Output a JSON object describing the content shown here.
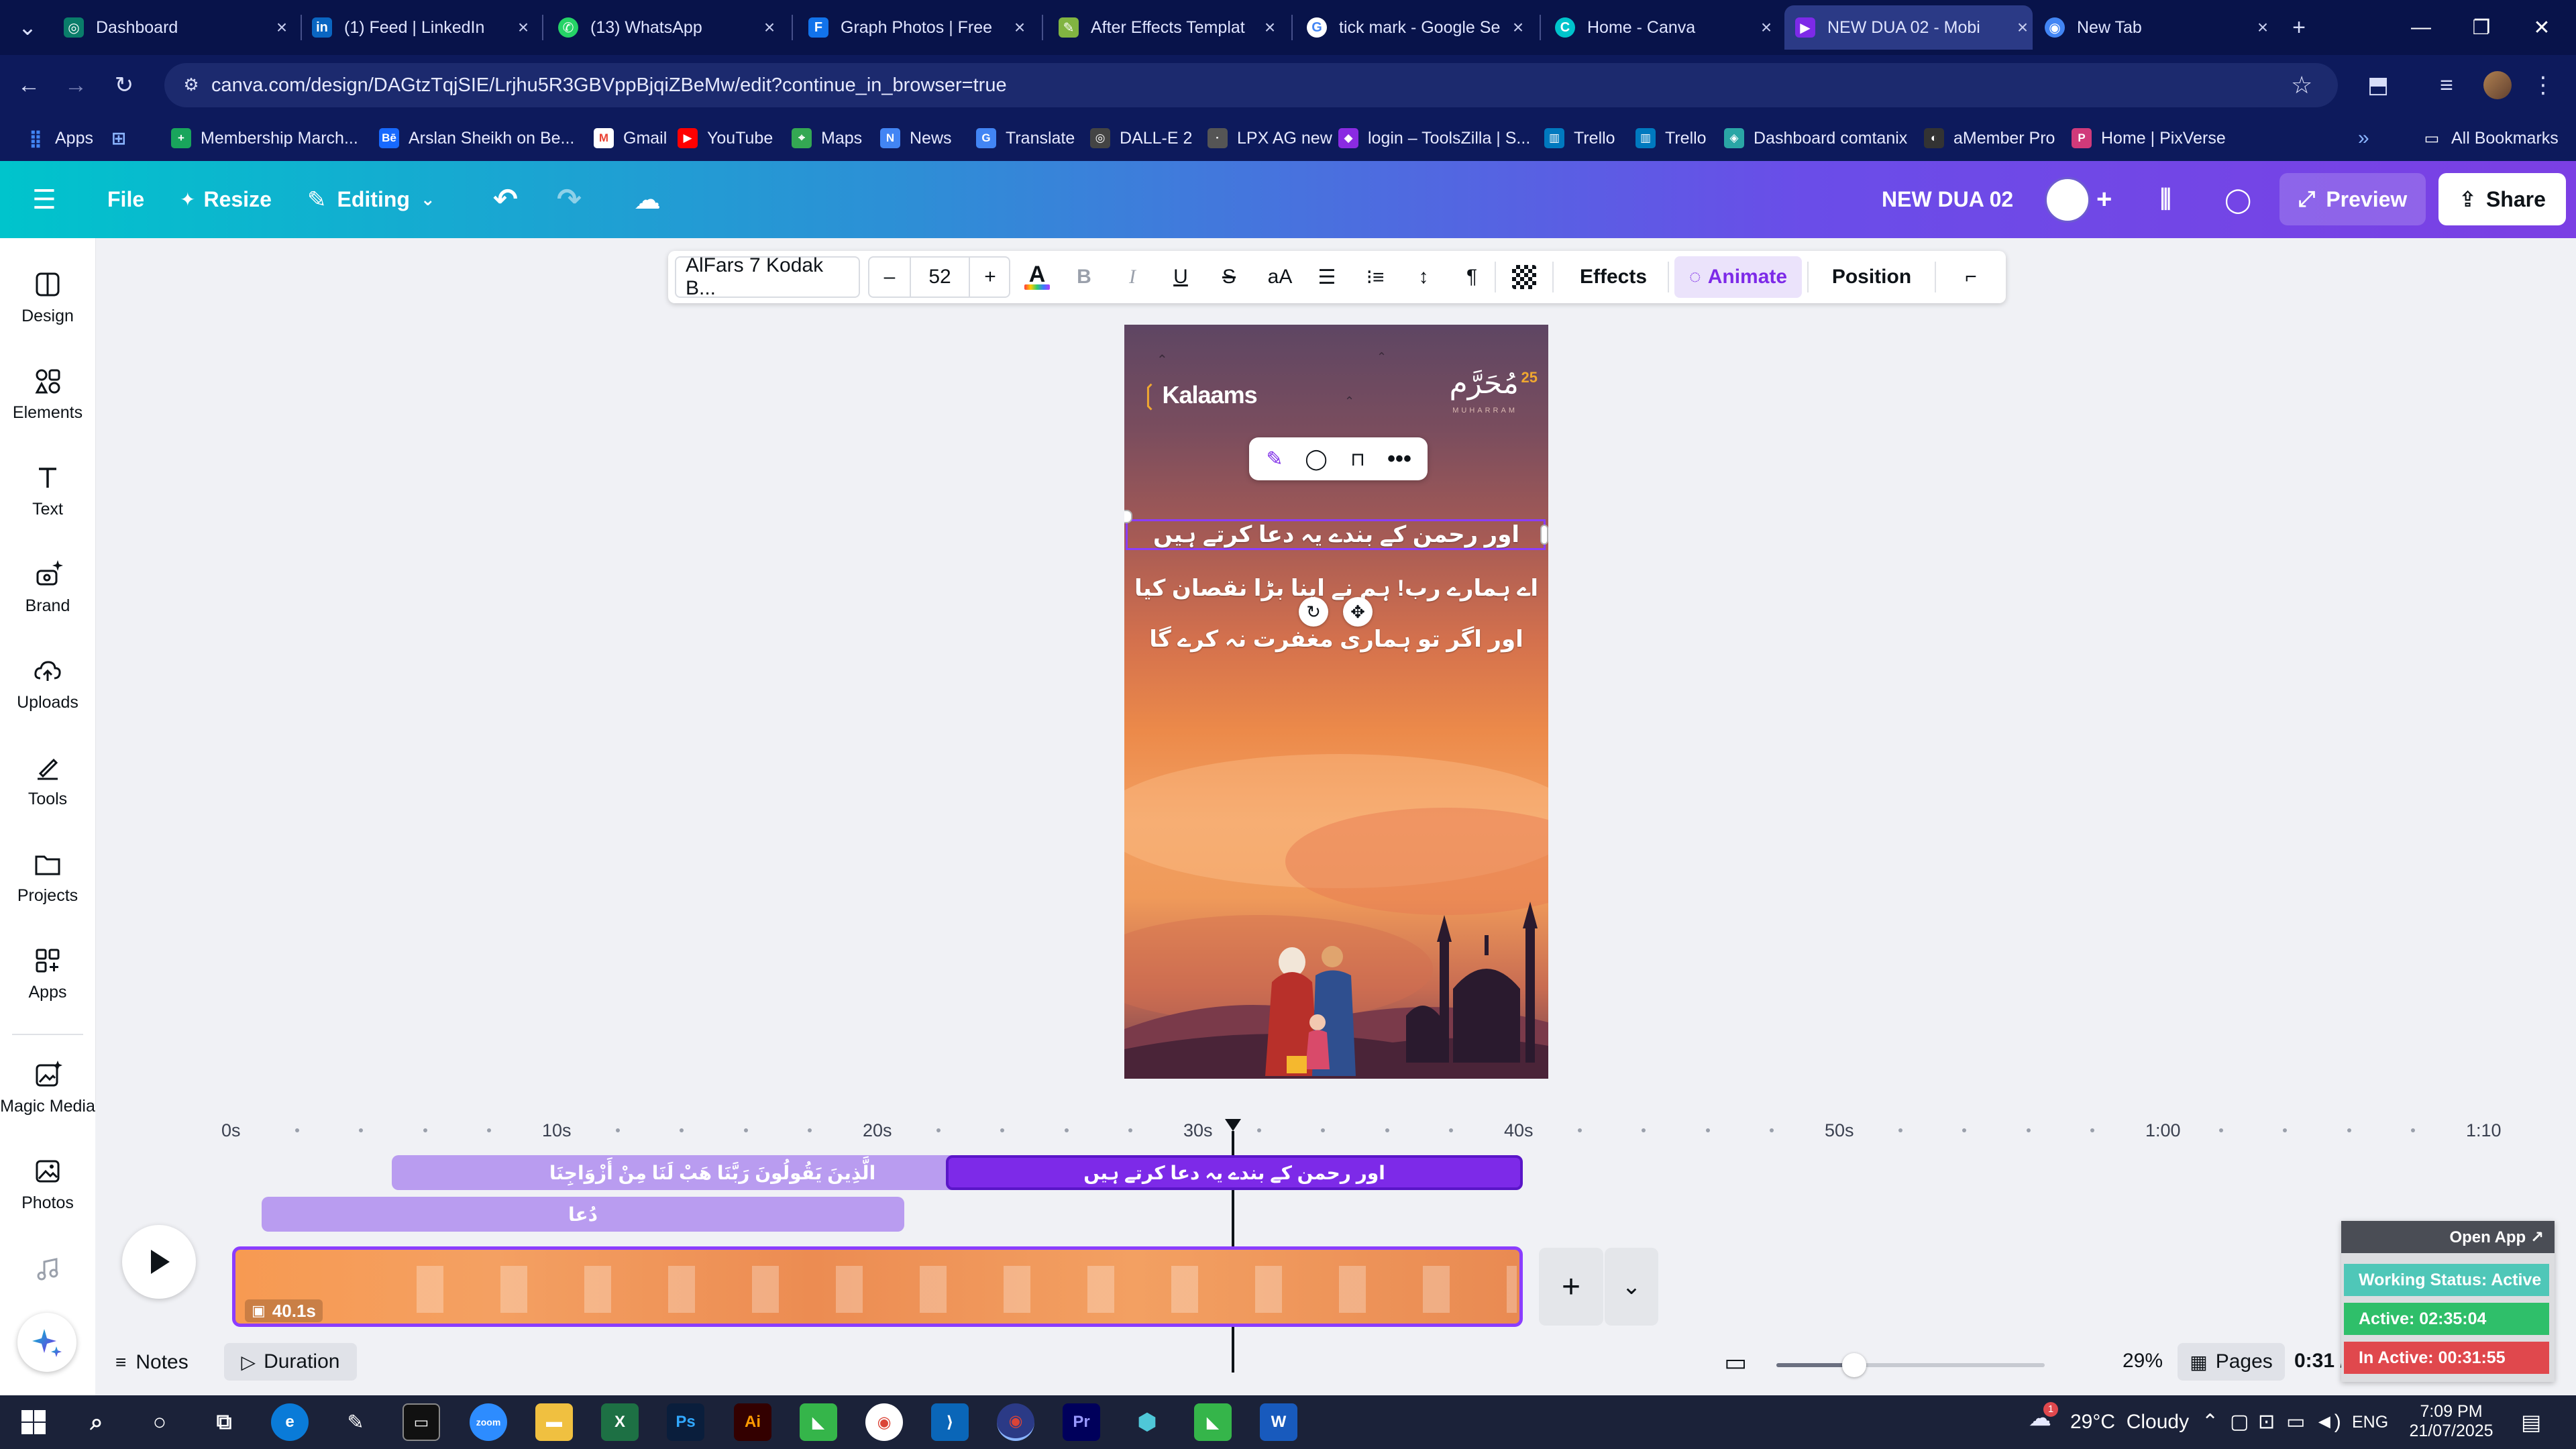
{
  "browser": {
    "tabs": [
      {
        "title": "Dashboard",
        "icon": "dashboard-icon",
        "color": "#0a7d6a"
      },
      {
        "title": "(1) Feed | LinkedIn",
        "icon": "linkedin-icon",
        "color": "#0a66c2"
      },
      {
        "title": "(13) WhatsApp",
        "icon": "whatsapp-icon",
        "color": "#25d366"
      },
      {
        "title": "Graph Photos | Free",
        "icon": "freepik-icon",
        "color": "#1273eb"
      },
      {
        "title": "After Effects Templat",
        "icon": "envato-icon",
        "color": "#81b441"
      },
      {
        "title": "tick mark - Google Se",
        "icon": "google-icon",
        "color": "#ffffff"
      },
      {
        "title": "Home - Canva",
        "icon": "canva-icon",
        "color": "#00c4cc"
      },
      {
        "title": "NEW DUA 02 - Mobi",
        "icon": "canva-icon",
        "color": "#7d2ae8"
      },
      {
        "title": "New Tab",
        "icon": "chrome-icon",
        "color": "#4285f4"
      }
    ],
    "url": "canva.com/design/DAGtzTqjSIE/Lrjhu5R3GBVppBjqiZBeMw/edit?continue_in_browser=true",
    "bookmarks": [
      {
        "label": "Apps",
        "color": "#4285f4"
      },
      {
        "label": "",
        "color": "#4285f4"
      },
      {
        "label": "Membership March...",
        "color": "#19a55c"
      },
      {
        "label": "Arslan Sheikh on Be...",
        "color": "#1769ff"
      },
      {
        "label": "Gmail",
        "color": "#ea4335"
      },
      {
        "label": "YouTube",
        "color": "#ff0000"
      },
      {
        "label": "Maps",
        "color": "#34a853"
      },
      {
        "label": "News",
        "color": "#4285f4"
      },
      {
        "label": "Translate",
        "color": "#4285f4"
      },
      {
        "label": "DALL-E 2",
        "color": "#444444"
      },
      {
        "label": "LPX AG new",
        "color": "#555555"
      },
      {
        "label": "login – ToolsZilla | S...",
        "color": "#8a2be2"
      },
      {
        "label": "Trello",
        "color": "#0079bf"
      },
      {
        "label": "Trello",
        "color": "#0079bf"
      },
      {
        "label": "Dashboard comtanix",
        "color": "#2aa6a6"
      },
      {
        "label": "aMember Pro",
        "color": "#333333"
      },
      {
        "label": "Home | PixVerse",
        "color": "#d03a7a"
      }
    ],
    "all_bookmarks": "All Bookmarks"
  },
  "canva": {
    "header": {
      "file": "File",
      "resize": "Resize",
      "editing": "Editing",
      "title": "NEW DUA 02",
      "preview": "Preview",
      "share": "Share"
    },
    "sidebar": [
      {
        "label": "Design",
        "icon": "design-icon"
      },
      {
        "label": "Elements",
        "icon": "elements-icon"
      },
      {
        "label": "Text",
        "icon": "text-icon"
      },
      {
        "label": "Brand",
        "icon": "brand-icon"
      },
      {
        "label": "Uploads",
        "icon": "uploads-icon"
      },
      {
        "label": "Tools",
        "icon": "tools-icon"
      },
      {
        "label": "Projects",
        "icon": "projects-icon"
      },
      {
        "label": "Apps",
        "icon": "apps-icon"
      },
      {
        "label": "Magic Media",
        "icon": "magic-media-icon"
      },
      {
        "label": "Photos",
        "icon": "photos-icon"
      }
    ],
    "toolbar": {
      "font": "AlFars 7 Kodak B...",
      "size": "52",
      "minus": "–",
      "plus": "+",
      "bold": "B",
      "italic": "I",
      "underline": "U",
      "strike": "S",
      "case": "aA",
      "effects": "Effects",
      "animate": "Animate",
      "position": "Position"
    },
    "design": {
      "logo": "Kalaams",
      "badge_number": "25",
      "badge_text": "مُحَرَّم",
      "badge_caption": "MUHARRAM",
      "line1": "اور رحمن کے بندے یہ دعا کرتے ہیں",
      "line2": "اے ہمارے رب! ہم نے اپنا بڑا نقصان کیا",
      "line3": "اور اگر تو ہماری مغفرت نہ کرے گا"
    },
    "timeline": {
      "ticks": [
        "0s",
        "10s",
        "20s",
        "30s",
        "40s",
        "50s",
        "1:00",
        "1:10"
      ],
      "clip_a": "الَّذِينَ يَقُولُونَ رَبَّنَا هَبْ لَنَا مِنْ أَزْوَاجِنَا",
      "clip_b": "اور رحمن کے بندے یہ دعا کرتے ہیں",
      "clip_c": "دُعا",
      "video_duration": "40.1s"
    },
    "footer": {
      "notes": "Notes",
      "duration": "Duration",
      "zoom": "29%",
      "pages": "Pages",
      "time": "0:31 / 0:40"
    },
    "zoom_level": 0.29,
    "playhead_seconds": 31
  },
  "widget": {
    "open_app": "Open App ↗",
    "working_status": "Working Status: Active",
    "active": "Active: 02:35:04",
    "inactive": "In Active: 00:31:55"
  },
  "taskbar": {
    "weather": "29°C  Cloudy",
    "lang": "ENG",
    "time": "7:09 PM",
    "date": "21/07/2025",
    "notif_count": "1"
  }
}
